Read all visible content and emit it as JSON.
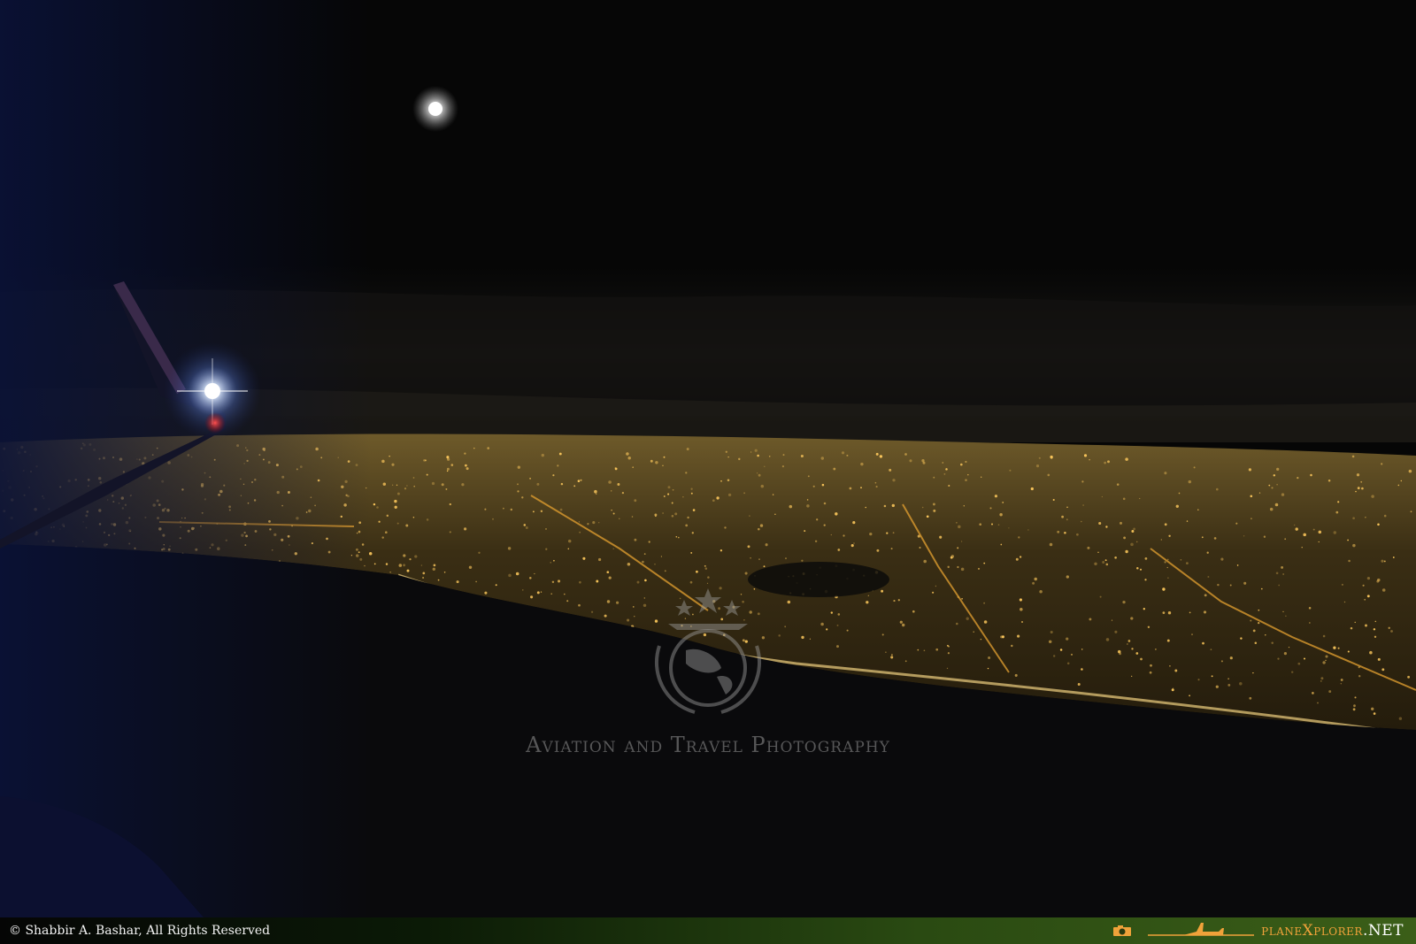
{
  "watermark": {
    "caption": "Aviation and Travel Photography"
  },
  "footer": {
    "copyright": "© Shabbir A. Bashar, All Rights Reserved",
    "brand_main": "planeXplorer",
    "brand_tld": ".NET"
  },
  "icons": [
    "camera-icon",
    "airplane-icon",
    "globe-emblem-icon"
  ],
  "colors": {
    "sky": "#050505",
    "city_lights": "#f2b640",
    "wing_light": "#ffffff",
    "brand_orange": "#f0a23a",
    "footer_green": "#3b5e18"
  }
}
